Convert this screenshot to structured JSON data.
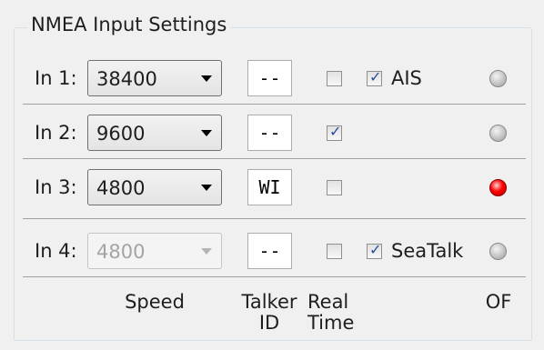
{
  "group_title": "NMEA Input Settings",
  "inputs": [
    {
      "label": "In 1:",
      "speed": "38400",
      "talker": "--",
      "realtime": false,
      "extra_checked": true,
      "extra_label": "AIS",
      "status": "off",
      "disabled": false
    },
    {
      "label": "In 2:",
      "speed": "9600",
      "talker": "--",
      "realtime": true,
      "extra_checked": null,
      "extra_label": "",
      "status": "off",
      "disabled": false
    },
    {
      "label": "In 3:",
      "speed": "4800",
      "talker": "WI",
      "realtime": false,
      "extra_checked": null,
      "extra_label": "",
      "status": "on",
      "disabled": false
    },
    {
      "label": "In 4:",
      "speed": "4800",
      "talker": "--",
      "realtime": false,
      "extra_checked": true,
      "extra_label": "SeaTalk",
      "status": "off",
      "disabled": true
    }
  ],
  "columns": {
    "speed": "Speed",
    "talker_1": "Talker",
    "talker_2": "ID",
    "realtime_1": "Real",
    "realtime_2": "Time",
    "status": "OF"
  },
  "colors": {
    "led_on": "#ff0000",
    "led_off": "#c4c4c4",
    "check": "#2a4c96"
  }
}
